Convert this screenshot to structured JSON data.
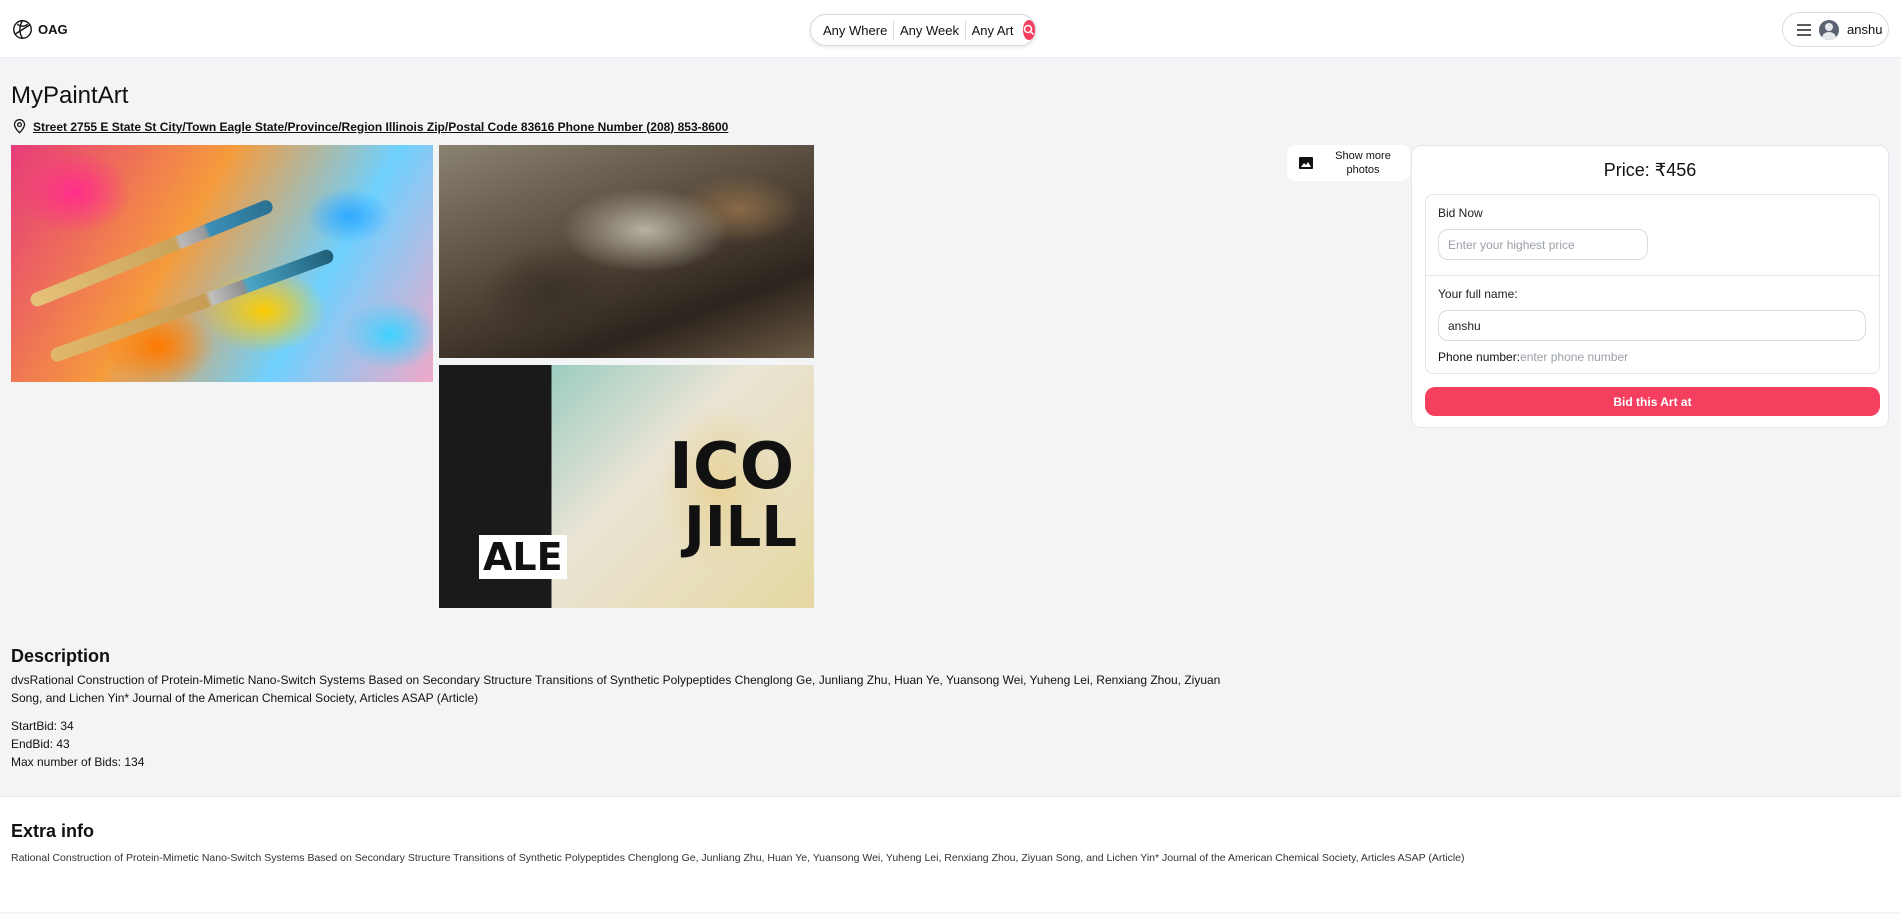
{
  "header": {
    "logo_text": "OAG",
    "search": {
      "where": "Any Where",
      "week": "Any Week",
      "art": "Any Art"
    },
    "user_name": "anshu"
  },
  "listing": {
    "title": "MyPaintArt",
    "address": "Street 2755 E State St City/Town Eagle State/Province/Region Illinois Zip/Postal Code 83616 Phone Number (208) 853-8600",
    "show_more_label": "Show more photos"
  },
  "bid_card": {
    "price": "Price: ₹456",
    "bid_now_label": "Bid Now",
    "bid_placeholder": "Enter your highest price",
    "name_label": "Your full name:",
    "name_value": "anshu",
    "phone_label": "Phone number:",
    "phone_placeholder": "enter phone number",
    "submit_label": "Bid this Art at"
  },
  "description": {
    "heading": "Description",
    "text": "dvsRational Construction of Protein-Mimetic Nano-Switch Systems Based on Secondary Structure Transitions of Synthetic Polypeptides Chenglong Ge, Junliang Zhu, Huan Ye, Yuansong Wei, Yuheng Lei, Renxiang Zhou, Ziyuan Song, and Lichen Yin* Journal of the American Chemical Society, Articles ASAP (Article)",
    "start_bid": "StartBid: 34",
    "end_bid": "EndBid: 43",
    "max_bids": "Max number of Bids: 134"
  },
  "extra_info": {
    "heading": "Extra info",
    "text": "Rational Construction of Protein-Mimetic Nano-Switch Systems Based on Secondary Structure Transitions of Synthetic Polypeptides Chenglong Ge, Junliang Zhu, Huan Ye, Yuansong Wei, Yuheng Lei, Renxiang Zhou, Ziyuan Song, and Lichen Yin* Journal of the American Chemical Society, Articles ASAP (Article)"
  },
  "colors": {
    "accent": "#f43f5e",
    "background": "#f3f4f6",
    "card": "#ffffff"
  },
  "icons": [
    "logo-icon",
    "search-icon",
    "menu-icon",
    "avatar-icon",
    "location-pin-icon",
    "image-icon"
  ]
}
